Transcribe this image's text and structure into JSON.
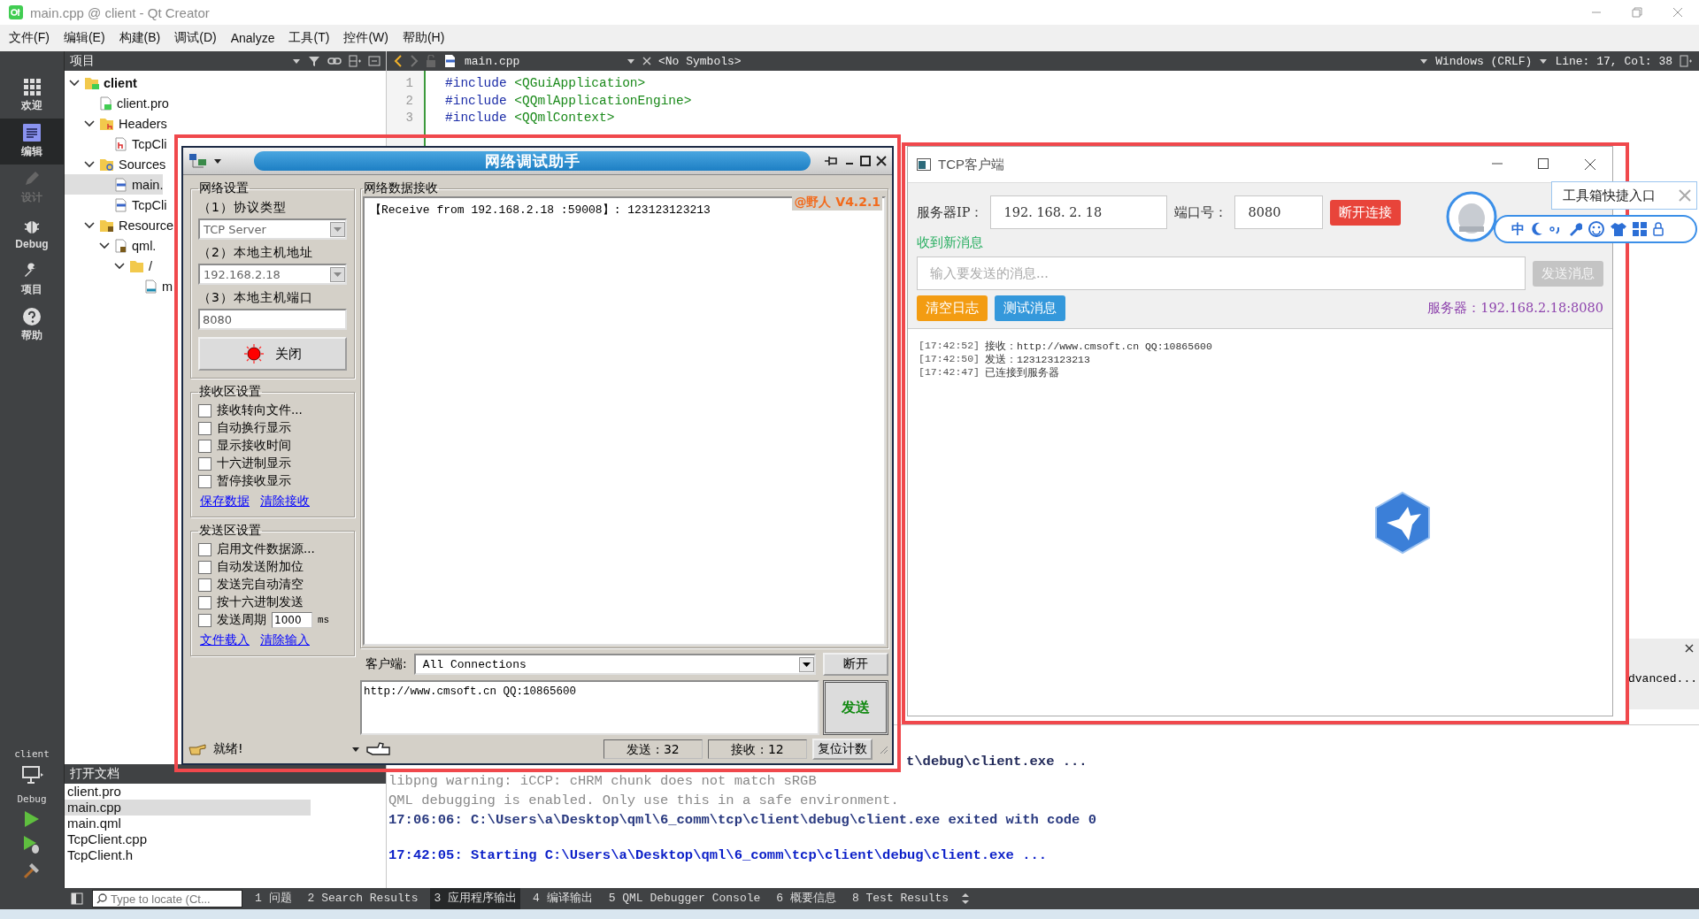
{
  "window": {
    "title": "main.cpp @ client - Qt Creator"
  },
  "menu": [
    "文件(F)",
    "编辑(E)",
    "构建(B)",
    "调试(D)",
    "Analyze",
    "工具(T)",
    "控件(W)",
    "帮助(H)"
  ],
  "mode_bar": {
    "items": [
      {
        "label": "欢迎",
        "kind": "welcome",
        "selected": false,
        "disabled": false
      },
      {
        "label": "编辑",
        "kind": "edit",
        "selected": true,
        "disabled": false
      },
      {
        "label": "设计",
        "kind": "design",
        "selected": false,
        "disabled": true
      },
      {
        "label": "Debug",
        "kind": "debug",
        "selected": false,
        "disabled": false
      },
      {
        "label": "项目",
        "kind": "projects",
        "selected": false,
        "disabled": false
      },
      {
        "label": "帮助",
        "kind": "help",
        "selected": false,
        "disabled": false
      }
    ],
    "kit": {
      "project": "client",
      "build": "Debug"
    }
  },
  "project_pane": {
    "title": "项目",
    "tree": [
      {
        "label": "client",
        "kind": "project",
        "selected": false,
        "expanded": true,
        "children": [
          {
            "label": "client.pro",
            "kind": "pro",
            "selected": false
          },
          {
            "label": "Headers",
            "kind": "headers",
            "selected": false,
            "expanded": true,
            "children": [
              {
                "label": "TcpCli",
                "kind": "h",
                "selected": false
              }
            ]
          },
          {
            "label": "Sources",
            "kind": "sources",
            "selected": false,
            "expanded": true,
            "children": [
              {
                "label": "main.",
                "kind": "cpp",
                "selected": true
              },
              {
                "label": "TcpCli",
                "kind": "cpp",
                "selected": false
              }
            ]
          },
          {
            "label": "Resource",
            "kind": "resources",
            "selected": false,
            "expanded": true,
            "children": [
              {
                "label": "qml.",
                "kind": "qrc",
                "selected": false,
                "expanded": true,
                "children": [
                  {
                    "label": "/",
                    "kind": "folder",
                    "selected": false,
                    "expanded": true,
                    "children": [
                      {
                        "label": "m",
                        "kind": "qml",
                        "selected": false
                      }
                    ]
                  }
                ]
              }
            ]
          }
        ]
      }
    ]
  },
  "open_documents": {
    "title": "打开文档",
    "items": [
      {
        "label": "client.pro",
        "selected": false
      },
      {
        "label": "main.cpp",
        "selected": true
      },
      {
        "label": "main.qml",
        "selected": false
      },
      {
        "label": "TcpClient.cpp",
        "selected": false
      },
      {
        "label": "TcpClient.h",
        "selected": false
      }
    ]
  },
  "editor": {
    "file": "main.cpp",
    "symbols": "<No Symbols>",
    "line_ending": "Windows (CRLF)",
    "position": "Line: 17, Col: 38",
    "lines": [
      {
        "number": "1",
        "keyword": "#include",
        "target": "<QGuiApplication>"
      },
      {
        "number": "2",
        "keyword": "#include",
        "target": "<QQmlApplicationEngine>"
      },
      {
        "number": "3",
        "keyword": "#include",
        "target": "<QQmlContext>"
      }
    ]
  },
  "output": {
    "lines": [
      {
        "kind": "cut",
        "text": "t\\debug\\client.exe ..."
      },
      {
        "kind": "note",
        "text": "libpng warning: iCCP: cHRM chunk does not match sRGB"
      },
      {
        "kind": "note",
        "text": "QML debugging is enabled. Only use this in a safe environment."
      },
      {
        "kind": "exit",
        "text": "17:06:06: C:\\Users\\a\\Desktop\\qml\\6_comm\\tcp\\client\\debug\\client.exe exited with code 0"
      },
      {
        "kind": "start",
        "text": "17:42:05: Starting C:\\Users\\a\\Desktop\\qml\\6_comm\\tcp\\client\\debug\\client.exe ..."
      }
    ]
  },
  "find_bar": {
    "text": "dvanced..."
  },
  "status_bar": {
    "locator_placeholder": "Type to locate (Ct...",
    "tabs": [
      {
        "label": "1 问题",
        "selected": false
      },
      {
        "label": "2 Search Results",
        "selected": false
      },
      {
        "label": "3 应用程序输出",
        "selected": true
      },
      {
        "label": "4 编译输出",
        "selected": false
      },
      {
        "label": "5 QML Debugger Console",
        "selected": false
      },
      {
        "label": "6 概要信息",
        "selected": false
      },
      {
        "label": "8 Test Results",
        "selected": false
      }
    ]
  },
  "net_assistant": {
    "title": "网络调试助手",
    "network_settings": {
      "title": "网络设置",
      "protocol_label": "（1）协议类型",
      "protocol": "TCP Server",
      "address_label": "（2）本地主机地址",
      "address": "192.168.2.18",
      "port_label": "（3）本地主机端口",
      "port": "8080",
      "toggle_button": "关闭",
      "listening": true
    },
    "receive_settings": {
      "title": "接收区设置",
      "options": [
        {
          "label": "接收转向文件...",
          "checked": false,
          "kind": "plain"
        },
        {
          "label": "自动换行显示",
          "checked": false,
          "kind": "plain"
        },
        {
          "label": "显示接收时间",
          "checked": false,
          "kind": "plain"
        },
        {
          "label": "十六进制显示",
          "checked": false,
          "kind": "plain"
        },
        {
          "label": "暂停接收显示",
          "checked": false,
          "kind": "plain"
        }
      ],
      "links": [
        "保存数据",
        "清除接收"
      ]
    },
    "send_settings": {
      "title": "发送区设置",
      "options": [
        {
          "label": "启用文件数据源...",
          "checked": false,
          "kind": "plain"
        },
        {
          "label": "自动发送附加位",
          "checked": false,
          "kind": "plain"
        },
        {
          "label": "发送完自动清空",
          "checked": false,
          "kind": "plain"
        },
        {
          "label": "按十六进制发送",
          "checked": false,
          "kind": "plain"
        },
        {
          "label": "发送周期",
          "checked": false,
          "kind": "period",
          "value": "1000",
          "unit": "ms"
        }
      ],
      "links": [
        "文件载入",
        "清除输入"
      ]
    },
    "receive": {
      "title": "网络数据接收",
      "version": "@野人 V4.2.1",
      "text": "【Receive from 192.168.2.18 :59008】: 123123123213"
    },
    "client_label": "客户端:",
    "client": "All Connections",
    "disconnect_button": "断开",
    "send_text": "http://www.cmsoft.cn QQ:10865600",
    "send_button": "发送",
    "status": "就绪!",
    "sent": "发送 : 32",
    "received": "接收 : 12",
    "reset_button": "复位计数"
  },
  "tcp_client": {
    "title": "TCP客户端",
    "ip_label": "服务器IP：",
    "ip": "192. 168. 2. 18",
    "port_label": "端口号：",
    "port": "8080",
    "connect_button": "断开连接",
    "notice": "收到新消息",
    "message_placeholder": "输入要发送的消息...",
    "send_button": "发送消息",
    "send_disabled": true,
    "clear_button": "清空日志",
    "test_button": "测试消息",
    "server": "服务器：192.168.2.18:8080",
    "log": [
      {
        "time": "[17:42:52]",
        "text": "接收：http://www.cmsoft.cn QQ:10865600"
      },
      {
        "time": "[17:42:50]",
        "text": "发送：123123123213"
      },
      {
        "time": "[17:42:47]",
        "text": "已连接到服务器"
      }
    ]
  },
  "qq_toolbar": {
    "tooltip": "工具箱快捷入口",
    "input_mode": "中"
  }
}
